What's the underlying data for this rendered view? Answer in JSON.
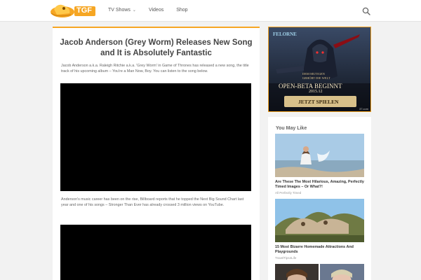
{
  "site": {
    "logo_text": "TGF"
  },
  "nav": {
    "items": [
      {
        "label": "TV Shows",
        "has_dropdown": true
      },
      {
        "label": "Videos",
        "has_dropdown": false
      },
      {
        "label": "Shop",
        "has_dropdown": false
      }
    ],
    "search_icon": "search-icon"
  },
  "article": {
    "title": "Jacob Anderson (Grey Worm) Releases New Song and It is Absolutely Fantastic",
    "paragraph1": "Jacob Anderson a.k.a. Raleigh Ritchie a.k.a. 'Grey Worm' in Game of Thrones has released a new song, the title track of his upcoming album – You're a Man Now, Boy. You can listen to the song below.",
    "paragraph2": "Anderson's music career has been on the rise, Billboard reports that he topped the Next Big Sound Chart last year and one of his songs – Stronger Than Ever has already crossed 3 million views on YouTube."
  },
  "ad": {
    "brand": "FELORNE",
    "line1": "DEM MUTIGEN",
    "line2": "GEHÖRT DIE WELT",
    "line3": "OPEN-BETA BEGINNT",
    "line4": "2015.12",
    "button": "JETZT SPIELEN",
    "corner": "37.com"
  },
  "you_may_like": {
    "heading": "You May Like",
    "items": [
      {
        "title": "Are These The Most Hilarious, Amazing, Perfectly Timed Images – Or What?!",
        "source": "All Perfectly Timed"
      },
      {
        "title": "15 Most Bizarre Homemade Attractions And Playgrounds",
        "source": "TravelTips4Life"
      }
    ]
  },
  "colors": {
    "accent": "#f6a623",
    "page_bg": "#f2f2f2"
  }
}
